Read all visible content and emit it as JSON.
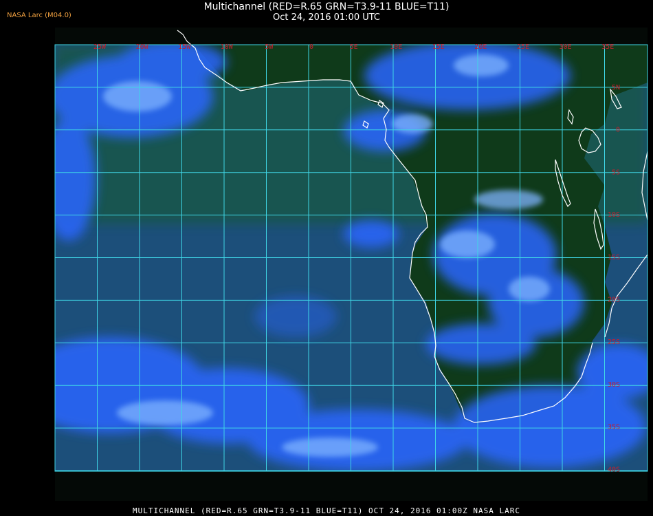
{
  "header": {
    "producer": "NASA Larc (M04.0)",
    "title": "Multichannel (RED=R.65 GRN=T3.9-11 BLUE=T11)",
    "datetime": "Oct 24, 2016 01:00 UTC"
  },
  "footer": {
    "caption": "MULTICHANNEL (RED=R.65 GRN=T3.9-11 BLUE=T11) OCT 24, 2016 01:00Z   NASA LARC"
  },
  "map": {
    "grid_color": "#3fd6e6",
    "label_color": "#c81e2d",
    "coastline_color": "#ffffff",
    "ocean_color": "#1c4f7a",
    "land_color": "#0f3a1a",
    "cloud_color": "#2a66ff",
    "longitude_labels": [
      "25W",
      "20W",
      "15W",
      "10W",
      "5W",
      "0",
      "5E",
      "10E",
      "15E",
      "20E",
      "25E",
      "30E",
      "35E"
    ],
    "latitude_labels": [
      "5N",
      "0",
      "5S",
      "10S",
      "15S",
      "20S",
      "25S",
      "30S",
      "35S",
      "40S"
    ]
  }
}
